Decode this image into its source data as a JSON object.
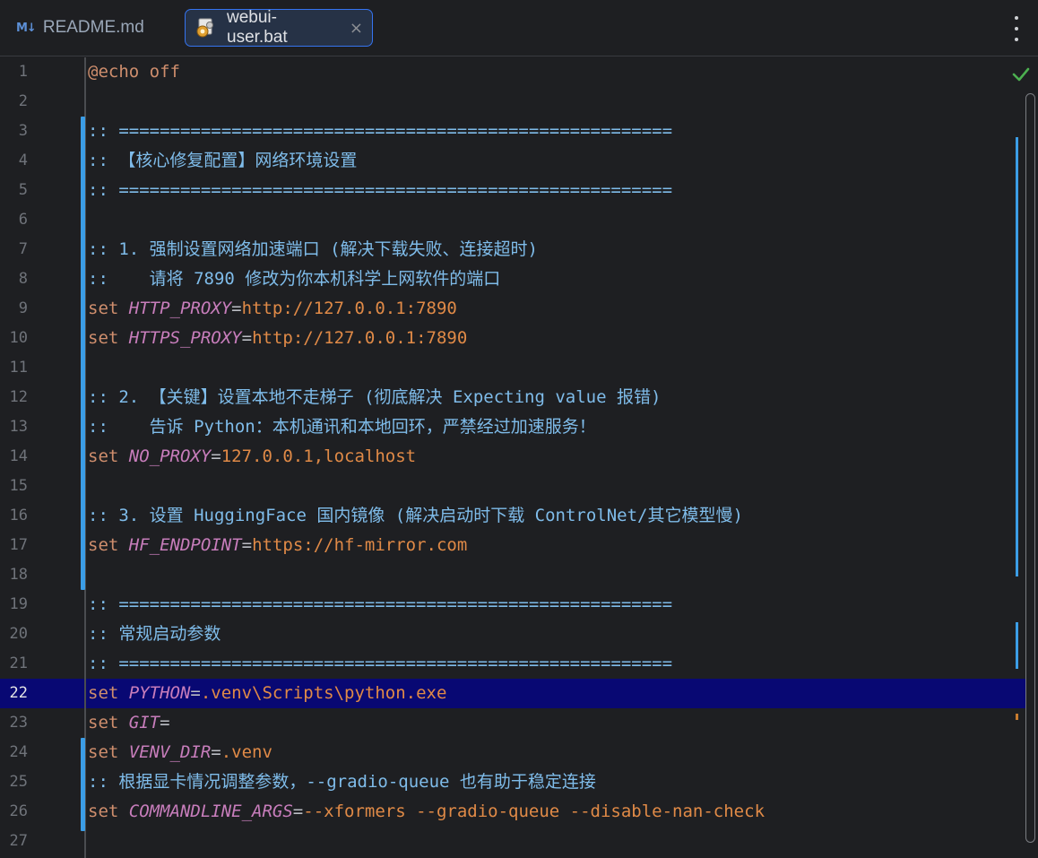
{
  "tabs": [
    {
      "label": "README.md",
      "icon": "markdown-icon",
      "active": false
    },
    {
      "label": "webui-user.bat",
      "icon": "bat-file-icon",
      "active": true,
      "close": "×"
    }
  ],
  "editor": {
    "current_line": 22,
    "lines": [
      {
        "n": "1",
        "segs": [
          [
            "c-kw",
            "@echo off"
          ]
        ]
      },
      {
        "n": "2",
        "segs": []
      },
      {
        "n": "3",
        "segs": [
          [
            "c-comment",
            ":: ======================================================"
          ]
        ]
      },
      {
        "n": "4",
        "segs": [
          [
            "c-comment",
            ":: 【核心修复配置】网络环境设置"
          ]
        ]
      },
      {
        "n": "5",
        "segs": [
          [
            "c-comment",
            ":: ======================================================"
          ]
        ]
      },
      {
        "n": "6",
        "segs": []
      },
      {
        "n": "7",
        "segs": [
          [
            "c-comment",
            ":: 1. 强制设置网络加速端口 (解决下载失败、连接超时)"
          ]
        ]
      },
      {
        "n": "8",
        "segs": [
          [
            "c-comment",
            "::    请将 7890 修改为你本机科学上网软件的端口"
          ]
        ]
      },
      {
        "n": "9",
        "segs": [
          [
            "c-kw",
            "set "
          ],
          [
            "c-var",
            "HTTP_PROXY"
          ],
          [
            "c-op",
            "="
          ],
          [
            "c-val",
            "http://127.0.0.1:7890"
          ]
        ]
      },
      {
        "n": "10",
        "segs": [
          [
            "c-kw",
            "set "
          ],
          [
            "c-var",
            "HTTPS_PROXY"
          ],
          [
            "c-op",
            "="
          ],
          [
            "c-val",
            "http://127.0.0.1:7890"
          ]
        ]
      },
      {
        "n": "11",
        "segs": []
      },
      {
        "n": "12",
        "segs": [
          [
            "c-comment",
            ":: 2. 【关键】设置本地不走梯子 (彻底解决 Expecting value 报错)"
          ]
        ]
      },
      {
        "n": "13",
        "segs": [
          [
            "c-comment",
            "::    告诉 Python：本机通讯和本地回环，严禁经过加速服务！"
          ]
        ]
      },
      {
        "n": "14",
        "segs": [
          [
            "c-kw",
            "set "
          ],
          [
            "c-var",
            "NO_PROXY"
          ],
          [
            "c-op",
            "="
          ],
          [
            "c-val",
            "127.0.0.1,localhost"
          ]
        ]
      },
      {
        "n": "15",
        "segs": []
      },
      {
        "n": "16",
        "segs": [
          [
            "c-comment",
            ":: 3. 设置 HuggingFace 国内镜像 (解决启动时下载 ControlNet/其它模型慢)"
          ]
        ]
      },
      {
        "n": "17",
        "segs": [
          [
            "c-kw",
            "set "
          ],
          [
            "c-var",
            "HF_ENDPOINT"
          ],
          [
            "c-op",
            "="
          ],
          [
            "c-val",
            "https://hf-mirror.com"
          ]
        ]
      },
      {
        "n": "18",
        "segs": []
      },
      {
        "n": "19",
        "segs": [
          [
            "c-comment",
            ":: ======================================================"
          ]
        ]
      },
      {
        "n": "20",
        "segs": [
          [
            "c-comment",
            ":: 常规启动参数"
          ]
        ]
      },
      {
        "n": "21",
        "segs": [
          [
            "c-comment",
            ":: ======================================================"
          ]
        ]
      },
      {
        "n": "22",
        "segs": [
          [
            "c-kw",
            "set "
          ],
          [
            "c-var",
            "PYTHON"
          ],
          [
            "c-op",
            "="
          ],
          [
            "c-val",
            ".venv\\Scripts\\python.exe"
          ]
        ]
      },
      {
        "n": "23",
        "segs": [
          [
            "c-kw",
            "set "
          ],
          [
            "c-var",
            "GIT"
          ],
          [
            "c-op",
            "="
          ]
        ]
      },
      {
        "n": "24",
        "segs": [
          [
            "c-kw",
            "set "
          ],
          [
            "c-var",
            "VENV_DIR"
          ],
          [
            "c-op",
            "="
          ],
          [
            "c-val",
            ".venv"
          ]
        ]
      },
      {
        "n": "25",
        "segs": [
          [
            "c-comment",
            ":: 根据显卡情况调整参数，--gradio-queue 也有助于稳定连接"
          ]
        ]
      },
      {
        "n": "26",
        "segs": [
          [
            "c-kw",
            "set "
          ],
          [
            "c-var",
            "COMMANDLINE_ARGS"
          ],
          [
            "c-op",
            "="
          ],
          [
            "c-val",
            "--xformers --gradio-queue --disable-nan-check"
          ]
        ]
      },
      {
        "n": "27",
        "segs": []
      }
    ]
  },
  "status": {
    "inspection_icon": "check-icon"
  },
  "colors": {
    "accent": "#3574f0",
    "current_line_bg": "#080873",
    "change_marker": "#3b9de6",
    "check": "#4caf50"
  }
}
